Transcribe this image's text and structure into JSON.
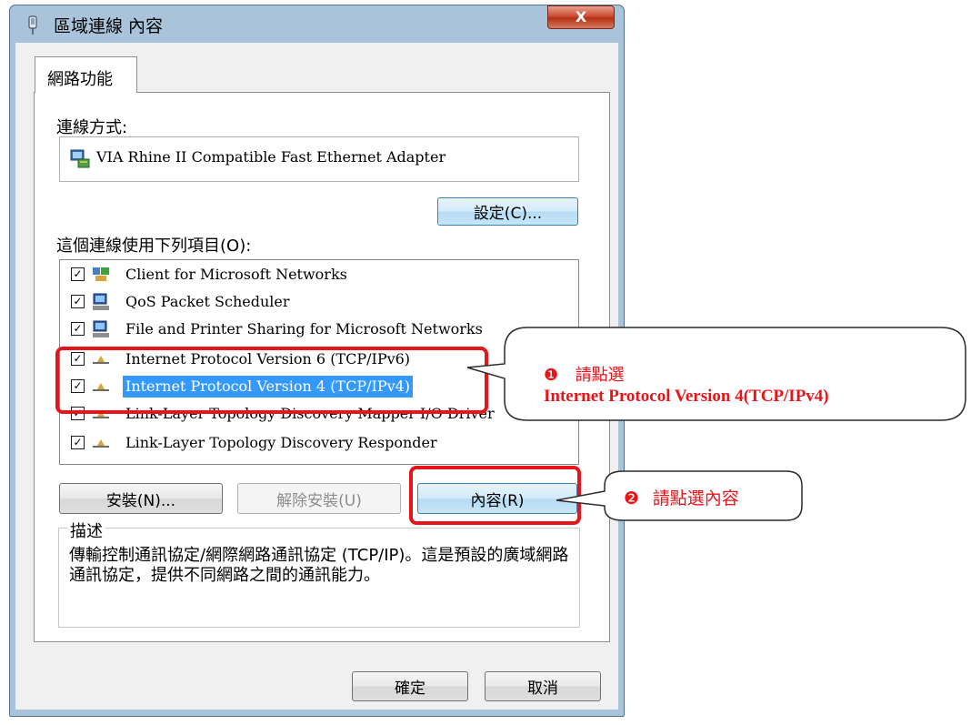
{
  "window": {
    "title": "區域連線 內容",
    "close_label": "X",
    "tab_label": "網路功能"
  },
  "connect_using": {
    "label": "連線方式:",
    "adapter": "VIA Rhine II Compatible Fast Ethernet Adapter",
    "configure_button": "設定(C)..."
  },
  "items": {
    "label": "這個連線使用下列項目(O):",
    "list": [
      {
        "label": "Client for Microsoft Networks",
        "checked": true,
        "icon": "network-client-icon"
      },
      {
        "label": "QoS Packet Scheduler",
        "checked": true,
        "icon": "computer-icon"
      },
      {
        "label": "File and Printer Sharing for Microsoft Networks",
        "checked": true,
        "icon": "computer-icon"
      },
      {
        "label": "Internet Protocol Version 6 (TCP/IPv6)",
        "checked": true,
        "icon": "protocol-icon"
      },
      {
        "label": "Internet Protocol Version 4 (TCP/IPv4)",
        "checked": true,
        "icon": "protocol-icon",
        "selected": true
      },
      {
        "label": "Link-Layer Topology Discovery Mapper I/O Driver",
        "checked": true,
        "icon": "protocol-icon"
      },
      {
        "label": "Link-Layer Topology Discovery Responder",
        "checked": true,
        "icon": "protocol-icon"
      }
    ]
  },
  "buttons": {
    "install": "安裝(N)...",
    "uninstall": "解除安裝(U)",
    "properties": "內容(R)",
    "ok": "確定",
    "cancel": "取消"
  },
  "description": {
    "label": "描述",
    "text": "傳輸控制通訊協定/網際網路通訊協定 (TCP/IP)。這是預設的廣域網路通訊協定，提供不同網路之間的通訊能力。"
  },
  "annotations": {
    "callout1_marker": "❶",
    "callout1_line1": "請點選",
    "callout1_line2": "Internet Protocol Version 4(TCP/IPv4)",
    "callout2_marker": "❷",
    "callout2_text": "請點選內容"
  },
  "colors": {
    "annotation_red": "#e8141a",
    "selection_blue": "#3399ff"
  }
}
